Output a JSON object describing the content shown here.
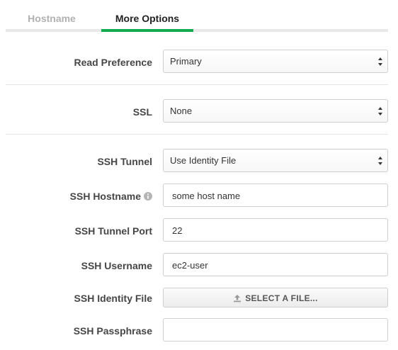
{
  "tabs": [
    {
      "label": "Hostname",
      "active": false
    },
    {
      "label": "More Options",
      "active": true
    }
  ],
  "read_preference": {
    "label": "Read Preference",
    "value": "Primary"
  },
  "ssl": {
    "label": "SSL",
    "value": "None"
  },
  "ssh_tunnel": {
    "label": "SSH Tunnel",
    "value": "Use Identity File"
  },
  "ssh_hostname": {
    "label": "SSH Hostname",
    "value": "some host name"
  },
  "ssh_tunnel_port": {
    "label": "SSH Tunnel Port",
    "value": "22"
  },
  "ssh_username": {
    "label": "SSH Username",
    "value": "ec2-user"
  },
  "ssh_identity_file": {
    "label": "SSH Identity File",
    "button_label": "SELECT A FILE..."
  },
  "ssh_passphrase": {
    "label": "SSH Passphrase",
    "value": ""
  },
  "icons": {
    "info": "info-icon",
    "upload": "upload-icon",
    "select_caret": "chevron-up-down-icon"
  },
  "colors": {
    "active_tab": "#13aa52",
    "inactive_tab": "#b1b1b1"
  }
}
